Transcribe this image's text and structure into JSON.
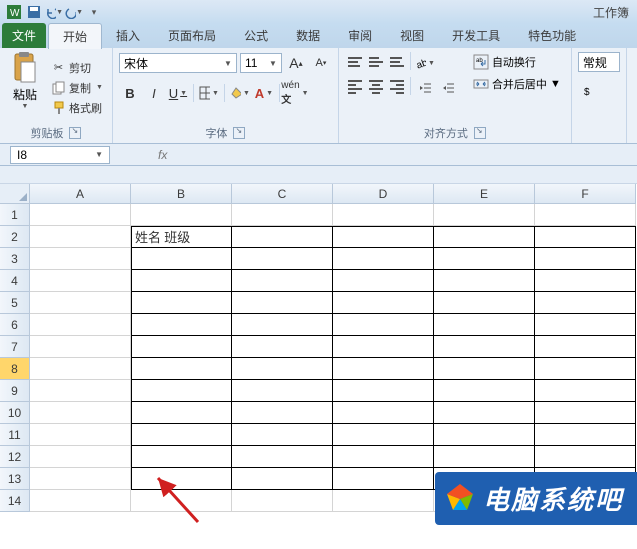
{
  "title": "工作簿",
  "qat": {
    "save": "保存",
    "undo": "撤销",
    "redo": "恢复"
  },
  "tabs": {
    "file": "文件",
    "items": [
      "开始",
      "插入",
      "页面布局",
      "公式",
      "数据",
      "审阅",
      "视图",
      "开发工具",
      "特色功能"
    ],
    "active_index": 0
  },
  "ribbon": {
    "clipboard": {
      "label": "剪贴板",
      "paste": "粘贴",
      "cut": "剪切",
      "copy": "复制",
      "format_painter": "格式刷"
    },
    "font": {
      "label": "字体",
      "name": "宋体",
      "size": "11",
      "bold": "B",
      "italic": "I",
      "underline": "U"
    },
    "alignment": {
      "label": "对齐方式",
      "wrap": "自动换行",
      "merge": "合并后居中"
    },
    "number": {
      "label_general": "常规"
    }
  },
  "namebox": {
    "cell": "I8",
    "fx": "fx"
  },
  "grid": {
    "columns": [
      "A",
      "B",
      "C",
      "D",
      "E",
      "F"
    ],
    "rows": [
      "1",
      "2",
      "3",
      "4",
      "5",
      "6",
      "7",
      "8",
      "9",
      "10",
      "11",
      "12",
      "13",
      "14"
    ],
    "selected_row": "8",
    "cell_B2": "姓名  班级"
  },
  "watermark": {
    "text": "电脑系统吧"
  },
  "colors": {
    "accent": "#2a6f2a",
    "ribbon_bg": "#ebf1f8",
    "file_tab": "#2c7c3a",
    "sel_row": "#ffd66b",
    "watermark_bg": "#1f5fb0"
  }
}
